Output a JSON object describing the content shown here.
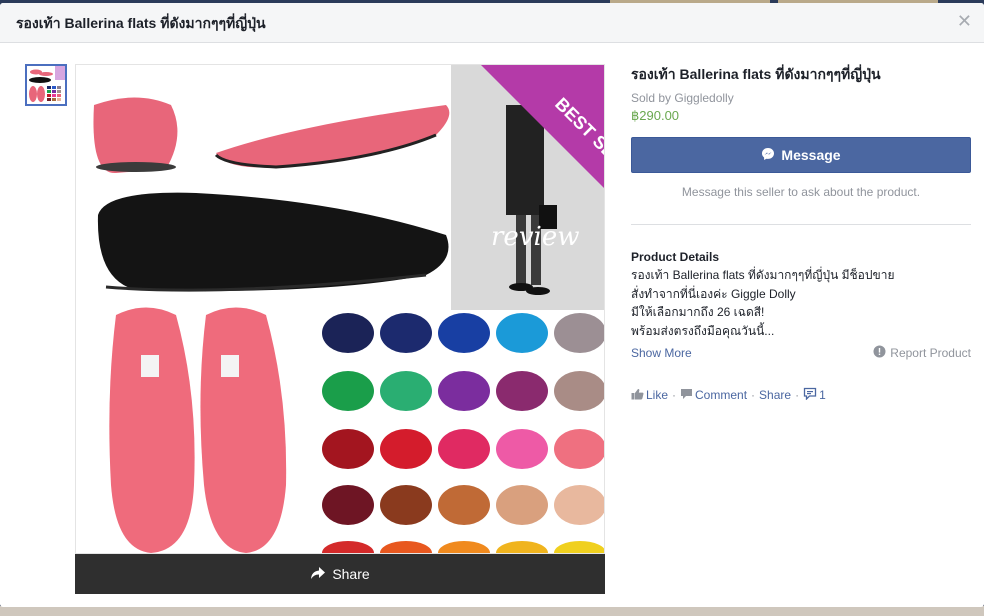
{
  "dialog": {
    "title": "รองเท้า Ballerina flats ที่ดังมากๆๆที่ญี่ปุ่น",
    "close_icon": "close-icon"
  },
  "gallery": {
    "photo_text": {
      "badge": "BEST SELLER",
      "review": "review"
    },
    "share_label": "Share"
  },
  "product": {
    "title": "รองเท้า Ballerina flats ที่ดังมากๆๆที่ญี่ปุ่น",
    "seller": "Sold by Giggledolly",
    "price": "฿290.00",
    "message_button": "Message",
    "message_hint": "Message this seller to ask about the product.",
    "details_heading": "Product Details",
    "details_lines": [
      "รองเท้า Ballerina flats ที่ดังมากๆๆที่ญี่ปุ่น มีช็อปขาย",
      "สั่งทำจากที่นี่เองค่ะ Giggle Dolly",
      "มีให้เลือกมากถึง 26 เฉดสี!",
      "พร้อมส่งตรงถึงมือคุณวันนี้..."
    ],
    "show_more": "Show More",
    "report": "Report Product"
  },
  "actions": {
    "like": "Like",
    "comment": "Comment",
    "share": "Share",
    "comment_count": "1"
  },
  "colors": {
    "accent_blue": "#4b67a1",
    "price_green": "#6aa84f",
    "muted_text": "#90949c"
  }
}
